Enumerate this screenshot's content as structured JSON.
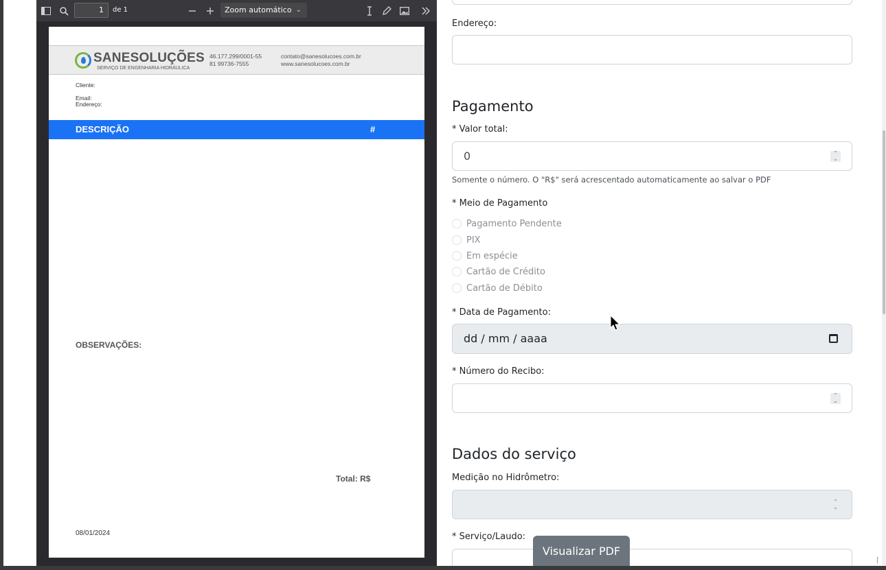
{
  "viewer": {
    "page_number": "1",
    "page_of": "de 1",
    "zoom": "Zoom automático"
  },
  "pdf": {
    "brand": "SANESOLUÇÕES",
    "brand_sub": "SERVIÇO DE ENGENHARIA HIDRÁULICA",
    "cnpj": "46.177.299/0001-55",
    "phone": "81 99736-7555",
    "email": "contato@sanesolucoes.com.br",
    "website": "www.sanesolucoes.com.br",
    "cliente_label": "Cliente:",
    "email_label": "Email:",
    "endereco_label": "Endereço:",
    "descricao_label": "DESCRIÇÃO",
    "hash_label": "#",
    "observacoes_label": "OBSERVAÇÕES:",
    "total_label": "Total: R$",
    "date": "08/01/2024"
  },
  "form": {
    "endereco_label": "Endereço:",
    "endereco_value": "",
    "pagamento_title": "Pagamento",
    "valor_total_label": "* Valor total:",
    "valor_total_value": "0",
    "valor_help": "Somente o número. O \"R$\" será acrescentado automaticamente ao salvar o PDF",
    "meio_pagamento_label": "* Meio de Pagamento",
    "meio_options": [
      "Pagamento Pendente",
      "PIX",
      "Em espécie",
      "Cartão de Crédito",
      "Cartão de Débito"
    ],
    "data_pagamento_label": "* Data de Pagamento:",
    "data_pagamento_placeholder": "dd / mm / aaaa",
    "numero_recibo_label": "* Número do Recibo:",
    "numero_recibo_value": "",
    "dados_servico_title": "Dados do serviço",
    "medicao_label": "Medição no Hidrômetro:",
    "servico_label": "* Serviço/Laudo:",
    "visualizar_button": "Visualizar PDF"
  }
}
